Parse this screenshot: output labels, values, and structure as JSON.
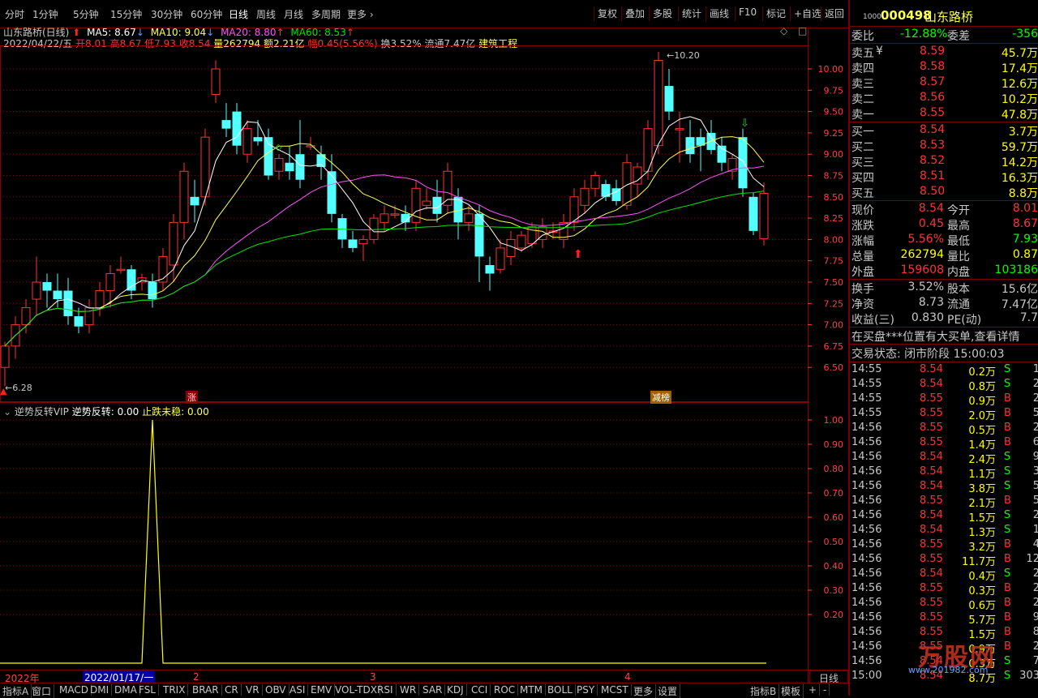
{
  "toolbar": {
    "periods": [
      "分时",
      "1分钟",
      "5分钟",
      "15分钟",
      "30分钟",
      "60分钟",
      "日线",
      "周线",
      "月线",
      "多周期",
      "更多"
    ],
    "right": [
      "复权",
      "叠加",
      "多股",
      "统计",
      "画线",
      "F10",
      "标记",
      "+自选",
      "返回"
    ]
  },
  "main_info": {
    "title": "山东路桥(日线)",
    "ma5": "MA5: 8.67",
    "ma10": "MA10: 9.04",
    "ma20": "MA20: 8.80",
    "ma60": "MA60: 8.53",
    "date": "2022/04/22/五",
    "open": "开8.01",
    "high": "高8.67",
    "low": "低7.93",
    "close": "收8.54",
    "vol": "量262794",
    "amount": "额2.21亿",
    "change": "幅0.45(5.56%)",
    "turnover": "换3.52%",
    "float": "流通7.47亿",
    "sector": "建筑工程"
  },
  "main_axis": [
    "10.00",
    "9.75",
    "9.50",
    "9.25",
    "9.00",
    "8.75",
    "8.50",
    "8.25",
    "8.00",
    "7.75",
    "7.50",
    "7.25",
    "7.00",
    "6.75",
    "6.50"
  ],
  "main_marks": {
    "high_label": "10.20",
    "low_label": "6.28",
    "zhang": "涨",
    "jianbang": "减榜"
  },
  "ind_info": {
    "name": "逆势反转VIP",
    "v1": "逆势反转: 0.00",
    "v2": "止跌未稳: 0.00"
  },
  "ind_axis": [
    "1.00",
    "0.90",
    "0.80",
    "0.70",
    "0.60",
    "0.50",
    "0.40",
    "0.30",
    "0.20"
  ],
  "date_axis": {
    "year": "2022年",
    "cursor": "2022/01/17/一",
    "m2": "2",
    "m3": "3",
    "m4": "4",
    "right_label": "日线"
  },
  "bottom_tabs": [
    "指标A",
    "窗口",
    "MACD",
    "DMI",
    "DMA",
    "FSL",
    "TRIX",
    "BRAR",
    "CR",
    "VR",
    "OBV",
    "ASI",
    "EMV",
    "VOL-TDX",
    "RSI",
    "WR",
    "SAR",
    "KDJ",
    "CCI",
    "ROC",
    "MTM",
    "BOLL",
    "PSY",
    "MCST",
    "更多",
    "设置",
    "指标B",
    "模板",
    "+",
    "-"
  ],
  "quote": {
    "code": "000498",
    "name": "山东路桥",
    "code_prefix": "1000",
    "weibi_label": "委比",
    "weibi": "-12.88%",
    "weicha_label": "委差",
    "weicha": "-356",
    "asks": [
      {
        "label": "卖五",
        "mark": "¥",
        "price": "8.59",
        "vol": "45.7万"
      },
      {
        "label": "卖四",
        "mark": "",
        "price": "8.58",
        "vol": "17.4万"
      },
      {
        "label": "卖三",
        "mark": "",
        "price": "8.57",
        "vol": "12.6万"
      },
      {
        "label": "卖二",
        "mark": "",
        "price": "8.56",
        "vol": "10.2万"
      },
      {
        "label": "卖一",
        "mark": "",
        "price": "8.55",
        "vol": "47.8万"
      }
    ],
    "bids": [
      {
        "label": "买一",
        "price": "8.54",
        "vol": "3.7万"
      },
      {
        "label": "买二",
        "price": "8.53",
        "vol": "59.7万"
      },
      {
        "label": "买三",
        "price": "8.52",
        "vol": "14.2万"
      },
      {
        "label": "买四",
        "price": "8.51",
        "vol": "16.3万"
      },
      {
        "label": "买五",
        "price": "8.50",
        "vol": "8.8万"
      }
    ],
    "stats": [
      {
        "l1": "现价",
        "v1": "8.54",
        "l2": "今开",
        "v2": "8.01"
      },
      {
        "l1": "涨跌",
        "v1": "0.45",
        "l2": "最高",
        "v2": "8.67"
      },
      {
        "l1": "涨幅",
        "v1": "5.56%",
        "l2": "最低",
        "v2": "7.93"
      },
      {
        "l1": "总量",
        "v1": "262794",
        "l2": "量比",
        "v2": "0.87"
      },
      {
        "l1": "外盘",
        "v1": "159608",
        "l2": "内盘",
        "v2": "103186"
      }
    ],
    "stats2": [
      {
        "l1": "换手",
        "v1": "3.52%",
        "l2": "股本",
        "v2": "15.6亿"
      },
      {
        "l1": "净资",
        "v1": "8.73",
        "l2": "流通",
        "v2": "7.47亿"
      },
      {
        "l1": "收益(三)",
        "v1": "0.830",
        "l2": "PE(动)",
        "v2": "7.7"
      }
    ],
    "notice": "在买盘***位置有大买单,查看详情",
    "status": "交易状态: 闭市阶段 15:00:03",
    "ticks": [
      {
        "t": "14:55",
        "p": "8.54",
        "v": "0.2万",
        "d": "S",
        "n": "1"
      },
      {
        "t": "14:55",
        "p": "8.54",
        "v": "0.8万",
        "d": "S",
        "n": "2"
      },
      {
        "t": "14:55",
        "p": "8.55",
        "v": "0.9万",
        "d": "B",
        "n": "2"
      },
      {
        "t": "14:55",
        "p": "8.55",
        "v": "2.0万",
        "d": "B",
        "n": "5"
      },
      {
        "t": "14:56",
        "p": "8.55",
        "v": "0.5万",
        "d": "B",
        "n": "2"
      },
      {
        "t": "14:56",
        "p": "8.55",
        "v": "1.4万",
        "d": "B",
        "n": "6"
      },
      {
        "t": "14:56",
        "p": "8.54",
        "v": "2.4万",
        "d": "S",
        "n": "9"
      },
      {
        "t": "14:56",
        "p": "8.54",
        "v": "1.1万",
        "d": "S",
        "n": "3"
      },
      {
        "t": "14:56",
        "p": "8.54",
        "v": "3.8万",
        "d": "S",
        "n": "5"
      },
      {
        "t": "14:56",
        "p": "8.55",
        "v": "2.1万",
        "d": "B",
        "n": "5"
      },
      {
        "t": "14:56",
        "p": "8.54",
        "v": "1.5万",
        "d": "S",
        "n": "2"
      },
      {
        "t": "14:56",
        "p": "8.54",
        "v": "1.3万",
        "d": "S",
        "n": "1"
      },
      {
        "t": "14:56",
        "p": "8.55",
        "v": "3.2万",
        "d": "B",
        "n": "4"
      },
      {
        "t": "14:56",
        "p": "8.55",
        "v": "11.7万",
        "d": "B",
        "n": "12"
      },
      {
        "t": "14:56",
        "p": "8.54",
        "v": "0.4万",
        "d": "S",
        "n": "2"
      },
      {
        "t": "14:56",
        "p": "8.55",
        "v": "0.3万",
        "d": "B",
        "n": "2"
      },
      {
        "t": "14:56",
        "p": "8.55",
        "v": "0.6万",
        "d": "B",
        "n": "2"
      },
      {
        "t": "14:56",
        "p": "8.55",
        "v": "5.7万",
        "d": "B",
        "n": "9"
      },
      {
        "t": "14:56",
        "p": "8.55",
        "v": "1.5万",
        "d": "B",
        "n": "8"
      },
      {
        "t": "14:56",
        "p": "8.55",
        "v": "0.9万",
        "d": "B",
        "n": "2"
      },
      {
        "t": "14:56",
        "p": "8.54",
        "v": "0.3万",
        "d": "S",
        "n": "7"
      },
      {
        "t": "15:00",
        "p": "8.54",
        "v": "8.7万",
        "d": "S",
        "n": "303"
      }
    ],
    "watermark": "万股网",
    "watermark_url": "www.201982.com"
  },
  "colors": {
    "up": "#ff3232",
    "down": "#54ffff",
    "ma5": "#ffffff",
    "ma10": "#ffff52",
    "ma20": "#ff52ff",
    "ma60": "#00e600",
    "grid": "#8b0000",
    "axis": "#ff4040",
    "yellow": "#ffff00",
    "green": "#00ff00"
  },
  "chart_data": {
    "type": "candlestick",
    "price_range": [
      6.28,
      10.2
    ],
    "candles": [
      {
        "o": 6.5,
        "h": 6.8,
        "l": 6.28,
        "c": 6.75
      },
      {
        "o": 6.75,
        "h": 7.1,
        "l": 6.6,
        "c": 7.0
      },
      {
        "o": 7.0,
        "h": 7.3,
        "l": 6.9,
        "c": 7.2
      },
      {
        "o": 7.3,
        "h": 7.8,
        "l": 7.1,
        "c": 7.5
      },
      {
        "o": 7.5,
        "h": 7.6,
        "l": 7.2,
        "c": 7.4
      },
      {
        "o": 7.4,
        "h": 7.6,
        "l": 7.2,
        "c": 7.3
      },
      {
        "o": 7.4,
        "h": 7.55,
        "l": 7.0,
        "c": 7.1
      },
      {
        "o": 7.1,
        "h": 7.2,
        "l": 6.9,
        "c": 6.98
      },
      {
        "o": 7.0,
        "h": 7.3,
        "l": 6.9,
        "c": 7.2
      },
      {
        "o": 7.2,
        "h": 7.5,
        "l": 7.1,
        "c": 7.4
      },
      {
        "o": 7.4,
        "h": 7.7,
        "l": 7.2,
        "c": 7.6
      },
      {
        "o": 7.65,
        "h": 7.8,
        "l": 7.6,
        "c": 7.65
      },
      {
        "o": 7.65,
        "h": 7.7,
        "l": 7.3,
        "c": 7.4
      },
      {
        "o": 7.5,
        "h": 7.6,
        "l": 7.4,
        "c": 7.55
      },
      {
        "o": 7.5,
        "h": 7.6,
        "l": 7.2,
        "c": 7.3
      },
      {
        "o": 7.5,
        "h": 7.9,
        "l": 7.4,
        "c": 7.8
      },
      {
        "o": 7.7,
        "h": 8.3,
        "l": 7.5,
        "c": 8.2
      },
      {
        "o": 8.2,
        "h": 8.9,
        "l": 8.0,
        "c": 8.8
      },
      {
        "o": 8.5,
        "h": 8.7,
        "l": 8.2,
        "c": 8.4
      },
      {
        "o": 8.5,
        "h": 9.3,
        "l": 8.4,
        "c": 9.2
      },
      {
        "o": 9.7,
        "h": 10.1,
        "l": 9.6,
        "c": 10.0
      },
      {
        "o": 9.4,
        "h": 9.6,
        "l": 9.2,
        "c": 9.3
      },
      {
        "o": 9.5,
        "h": 9.6,
        "l": 9.0,
        "c": 9.1
      },
      {
        "o": 9.0,
        "h": 9.4,
        "l": 8.9,
        "c": 9.3
      },
      {
        "o": 9.2,
        "h": 9.4,
        "l": 9.1,
        "c": 9.15
      },
      {
        "o": 9.2,
        "h": 9.3,
        "l": 8.7,
        "c": 8.75
      },
      {
        "o": 8.8,
        "h": 9.0,
        "l": 8.7,
        "c": 8.95
      },
      {
        "o": 8.9,
        "h": 9.1,
        "l": 8.7,
        "c": 8.8
      },
      {
        "o": 9.0,
        "h": 9.4,
        "l": 8.6,
        "c": 8.7
      },
      {
        "o": 9.1,
        "h": 9.2,
        "l": 9.05,
        "c": 9.1
      },
      {
        "o": 9.0,
        "h": 9.1,
        "l": 8.7,
        "c": 8.85
      },
      {
        "o": 8.8,
        "h": 9.0,
        "l": 8.2,
        "c": 8.3
      },
      {
        "o": 8.25,
        "h": 8.3,
        "l": 7.9,
        "c": 8.0
      },
      {
        "o": 8.0,
        "h": 8.1,
        "l": 7.85,
        "c": 7.9
      },
      {
        "o": 7.95,
        "h": 8.05,
        "l": 7.75,
        "c": 8.0
      },
      {
        "o": 8.0,
        "h": 8.3,
        "l": 7.95,
        "c": 8.25
      },
      {
        "o": 8.2,
        "h": 8.4,
        "l": 8.1,
        "c": 8.3
      },
      {
        "o": 8.3,
        "h": 8.4,
        "l": 8.25,
        "c": 8.3
      },
      {
        "o": 8.3,
        "h": 8.4,
        "l": 8.1,
        "c": 8.2
      },
      {
        "o": 8.2,
        "h": 8.7,
        "l": 8.1,
        "c": 8.6
      },
      {
        "o": 8.4,
        "h": 8.6,
        "l": 8.35,
        "c": 8.45
      },
      {
        "o": 8.5,
        "h": 8.7,
        "l": 8.2,
        "c": 8.3
      },
      {
        "o": 8.4,
        "h": 8.9,
        "l": 8.3,
        "c": 8.8
      },
      {
        "o": 8.5,
        "h": 8.6,
        "l": 8.0,
        "c": 8.2
      },
      {
        "o": 8.2,
        "h": 8.4,
        "l": 8.1,
        "c": 8.3
      },
      {
        "o": 8.3,
        "h": 8.4,
        "l": 7.5,
        "c": 7.8
      },
      {
        "o": 7.7,
        "h": 7.8,
        "l": 7.4,
        "c": 7.6
      },
      {
        "o": 7.65,
        "h": 8.0,
        "l": 7.6,
        "c": 7.9
      },
      {
        "o": 7.8,
        "h": 8.1,
        "l": 7.7,
        "c": 8.0
      },
      {
        "o": 7.9,
        "h": 8.1,
        "l": 7.85,
        "c": 8.05
      },
      {
        "o": 7.95,
        "h": 8.2,
        "l": 7.9,
        "c": 8.15
      },
      {
        "o": 8.0,
        "h": 8.25,
        "l": 7.9,
        "c": 8.15
      },
      {
        "o": 8.1,
        "h": 8.2,
        "l": 8.0,
        "c": 8.1
      },
      {
        "o": 8.0,
        "h": 8.3,
        "l": 7.9,
        "c": 8.2
      },
      {
        "o": 8.2,
        "h": 8.6,
        "l": 8.1,
        "c": 8.5
      },
      {
        "o": 8.4,
        "h": 8.7,
        "l": 8.3,
        "c": 8.6
      },
      {
        "o": 8.6,
        "h": 8.8,
        "l": 8.5,
        "c": 8.75
      },
      {
        "o": 8.65,
        "h": 8.7,
        "l": 8.45,
        "c": 8.5
      },
      {
        "o": 8.6,
        "h": 8.7,
        "l": 8.4,
        "c": 8.45
      },
      {
        "o": 8.4,
        "h": 9.0,
        "l": 8.35,
        "c": 8.9
      },
      {
        "o": 8.65,
        "h": 8.9,
        "l": 8.5,
        "c": 8.85
      },
      {
        "o": 8.8,
        "h": 9.4,
        "l": 8.7,
        "c": 9.3
      },
      {
        "o": 9.1,
        "h": 10.2,
        "l": 9.0,
        "c": 10.1
      },
      {
        "o": 9.8,
        "h": 10.0,
        "l": 9.4,
        "c": 9.5
      },
      {
        "o": 9.3,
        "h": 9.5,
        "l": 8.9,
        "c": 9.3
      },
      {
        "o": 9.2,
        "h": 9.4,
        "l": 8.9,
        "c": 9.0
      },
      {
        "o": 9.2,
        "h": 9.3,
        "l": 8.8,
        "c": 9.1
      },
      {
        "o": 9.25,
        "h": 9.4,
        "l": 9.0,
        "c": 9.05
      },
      {
        "o": 9.1,
        "h": 9.2,
        "l": 8.8,
        "c": 8.9
      },
      {
        "o": 8.8,
        "h": 9.0,
        "l": 8.7,
        "c": 8.95
      },
      {
        "o": 9.2,
        "h": 9.3,
        "l": 8.5,
        "c": 8.6
      },
      {
        "o": 8.5,
        "h": 8.55,
        "l": 8.05,
        "c": 8.1
      },
      {
        "o": 8.01,
        "h": 8.67,
        "l": 7.93,
        "c": 8.54
      }
    ],
    "indicator": {
      "name": "逆势反转",
      "range": [
        0,
        1
      ],
      "spike_index": 14,
      "spike_value": 1.0
    }
  }
}
